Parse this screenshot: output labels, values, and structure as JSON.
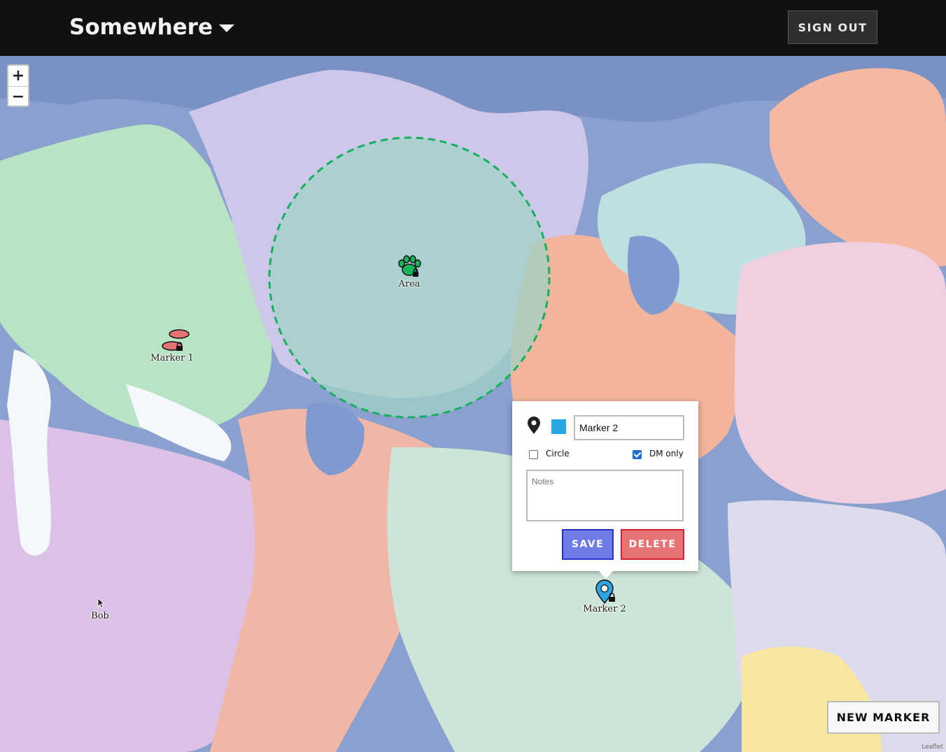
{
  "header": {
    "title": "Somewhere",
    "sign_out_label": "SIGN OUT"
  },
  "map": {
    "zoom_in_label": "+",
    "zoom_out_label": "−",
    "attribution": "Leaflet",
    "area": {
      "label": "Area",
      "icon": "paw-icon",
      "color": "#13b36b",
      "shape": "circle"
    },
    "markers": [
      {
        "label": "Marker 1",
        "icon": "footprints-icon",
        "color": "#e57373",
        "locked": true
      },
      {
        "label": "Marker 2",
        "icon": "map-pin-icon",
        "color": "#29a6e3",
        "locked": true
      },
      {
        "label": "Bob",
        "icon": "cursor-icon"
      }
    ]
  },
  "popup": {
    "icon": "map-pin-icon",
    "color": "#29a6e3",
    "name_value": "Marker 2",
    "circle_label": "Circle",
    "circle_checked": false,
    "dm_only_label": "DM only",
    "dm_only_checked": true,
    "notes_placeholder": "Notes",
    "save_label": "SAVE",
    "delete_label": "DELETE"
  },
  "new_marker_label": "NEW MARKER"
}
